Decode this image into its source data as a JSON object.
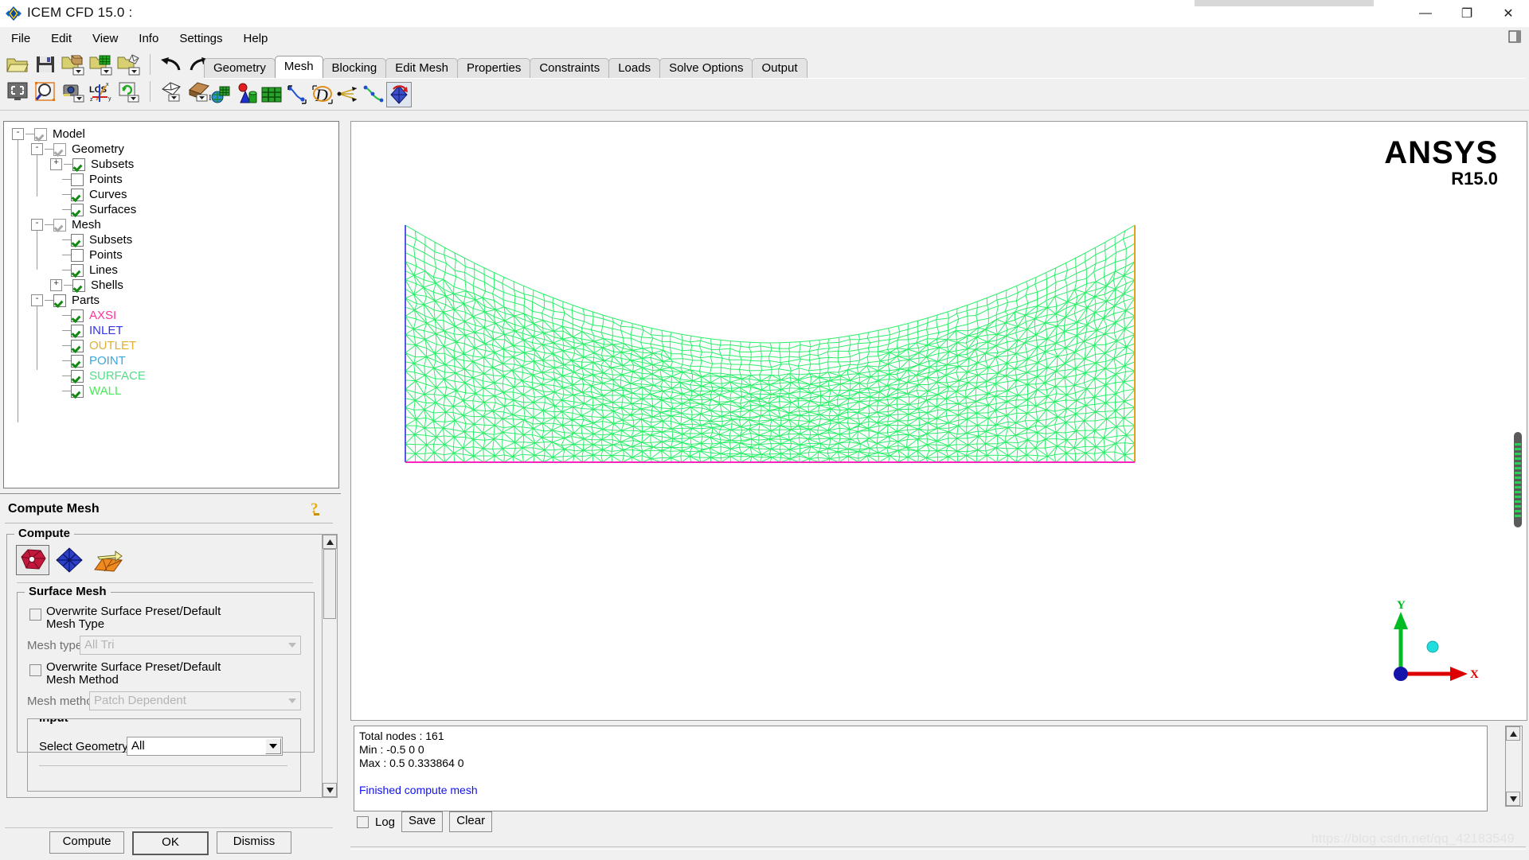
{
  "window": {
    "title": "ICEM CFD 15.0 :",
    "logo_icon": "ansys-diamond-icon",
    "minimize_label": "—",
    "maximize_label": "❐",
    "close_label": "✕",
    "dock_icon": "dock-icon"
  },
  "menubar": {
    "items": [
      {
        "label": "File"
      },
      {
        "label": "Edit"
      },
      {
        "label": "View"
      },
      {
        "label": "Info"
      },
      {
        "label": "Settings"
      },
      {
        "label": "Help"
      }
    ]
  },
  "toolbar": {
    "row1": [
      {
        "name": "open-folder-icon"
      },
      {
        "name": "save-icon"
      },
      {
        "name": "open-geometry-icon"
      },
      {
        "name": "open-mesh-icon"
      },
      {
        "name": "open-blocking-icon"
      },
      {
        "name": "undo-icon"
      },
      {
        "name": "redo-icon"
      }
    ],
    "row2": [
      {
        "name": "fit-window-icon"
      },
      {
        "name": "zoom-box-icon"
      },
      {
        "name": "save-picture-icon"
      },
      {
        "name": "lcs-axes-icon"
      },
      {
        "name": "refresh-icon"
      },
      {
        "name": "isometric-view-icon"
      },
      {
        "name": "box-view-icon"
      }
    ]
  },
  "tabs": {
    "items": [
      {
        "label": "Geometry",
        "active": false
      },
      {
        "label": "Mesh",
        "active": true
      },
      {
        "label": "Blocking",
        "active": false
      },
      {
        "label": "Edit Mesh",
        "active": false
      },
      {
        "label": "Properties",
        "active": false
      },
      {
        "label": "Constraints",
        "active": false
      },
      {
        "label": "Loads",
        "active": false
      },
      {
        "label": "Solve Options",
        "active": false
      },
      {
        "label": "Output",
        "active": false
      }
    ]
  },
  "mesh_toolbar": {
    "items": [
      {
        "name": "global-mesh-setup-icon",
        "selected": false
      },
      {
        "name": "part-mesh-setup-icon",
        "selected": false
      },
      {
        "name": "surface-mesh-setup-icon",
        "selected": false
      },
      {
        "name": "curve-mesh-setup-icon",
        "selected": false
      },
      {
        "name": "create-mesh-density-icon",
        "selected": false
      },
      {
        "name": "define-thin-cuts-icon",
        "selected": false
      },
      {
        "name": "edit-curve-mesh-icon",
        "selected": false
      },
      {
        "name": "compute-mesh-icon",
        "selected": true
      }
    ]
  },
  "tree": {
    "nodes": [
      {
        "label": "Model",
        "depth": 0,
        "toggle": "-",
        "check": "dim",
        "color": "#000000"
      },
      {
        "label": "Geometry",
        "depth": 1,
        "toggle": "-",
        "check": "dim",
        "color": "#000000"
      },
      {
        "label": "Subsets",
        "depth": 2,
        "toggle": "+",
        "check": "checked",
        "color": "#000000"
      },
      {
        "label": "Points",
        "depth": 2,
        "toggle": "",
        "check": "empty",
        "color": "#000000"
      },
      {
        "label": "Curves",
        "depth": 2,
        "toggle": "",
        "check": "checked",
        "color": "#000000"
      },
      {
        "label": "Surfaces",
        "depth": 2,
        "toggle": "",
        "check": "checked",
        "color": "#000000"
      },
      {
        "label": "Mesh",
        "depth": 1,
        "toggle": "-",
        "check": "dim",
        "color": "#000000"
      },
      {
        "label": "Subsets",
        "depth": 2,
        "toggle": "",
        "check": "checked",
        "color": "#000000"
      },
      {
        "label": "Points",
        "depth": 2,
        "toggle": "",
        "check": "empty",
        "color": "#000000"
      },
      {
        "label": "Lines",
        "depth": 2,
        "toggle": "",
        "check": "checked",
        "color": "#000000"
      },
      {
        "label": "Shells",
        "depth": 2,
        "toggle": "+",
        "check": "checked",
        "color": "#000000"
      },
      {
        "label": "Parts",
        "depth": 1,
        "toggle": "-",
        "check": "checked",
        "color": "#000000"
      },
      {
        "label": "AXSI",
        "depth": 2,
        "toggle": "",
        "check": "checked",
        "color": "#ff3399"
      },
      {
        "label": "INLET",
        "depth": 2,
        "toggle": "",
        "check": "checked",
        "color": "#3333ee"
      },
      {
        "label": "OUTLET",
        "depth": 2,
        "toggle": "",
        "check": "checked",
        "color": "#e0b030"
      },
      {
        "label": "POINT",
        "depth": 2,
        "toggle": "",
        "check": "checked",
        "color": "#3aa8e0"
      },
      {
        "label": "SURFACE",
        "depth": 2,
        "toggle": "",
        "check": "checked",
        "color": "#55dd88"
      },
      {
        "label": "WALL",
        "depth": 2,
        "toggle": "",
        "check": "checked",
        "color": "#44ee55"
      }
    ]
  },
  "compute_mesh": {
    "title": "Compute Mesh",
    "help_icon": "help-question-icon",
    "compute_group_label": "Compute",
    "compute_icons": [
      {
        "name": "volume-mesh-icon",
        "selected": true
      },
      {
        "name": "surface-mesh-icon",
        "selected": false
      },
      {
        "name": "prism-mesh-icon",
        "selected": false
      }
    ],
    "surface_mesh_group_label": "Surface Mesh",
    "overwrite_type_label_line1": "Overwrite Surface Preset/Default",
    "overwrite_type_label_line2": "Mesh Type",
    "mesh_type_label": "Mesh type",
    "mesh_type_value": "All Tri",
    "overwrite_method_label_line1": "Overwrite Surface Preset/Default",
    "overwrite_method_label_line2": "Mesh Method",
    "mesh_method_label": "Mesh method",
    "mesh_method_value": "Patch Dependent",
    "input_group_label": "Input",
    "select_geometry_label": "Select Geometry",
    "select_geometry_value": "All",
    "buttons": [
      {
        "label": "Compute",
        "name": "compute-button",
        "default": false
      },
      {
        "label": "OK",
        "name": "ok-button",
        "default": true
      },
      {
        "label": "Dismiss",
        "name": "dismiss-button",
        "default": false
      }
    ]
  },
  "viewport": {
    "brand_line1": "ANSYS",
    "brand_line2": "R15.0",
    "axis_x_label": "X",
    "axis_y_label": "Y",
    "axis_x_color": "#dd0000",
    "axis_y_color": "#00bb22",
    "origin_color": "#1414aa",
    "z_dot_color": "#22dddd",
    "mesh_color": "#2dee6a",
    "inlet_edge_color": "#5555ee",
    "outlet_edge_color": "#e0a020",
    "axsi_edge_color": "#ff22bb"
  },
  "messages": {
    "lines": [
      {
        "text": "Total nodes : 161",
        "color": "#000000"
      },
      {
        "text": "Min : -0.5 0 0",
        "color": "#000000"
      },
      {
        "text": "Max : 0.5 0.333864 0",
        "color": "#000000"
      },
      {
        "text": "",
        "color": "#000000"
      },
      {
        "text": "Finished compute mesh",
        "color": "#1111ee"
      }
    ],
    "log_checkbox_label": "Log",
    "save_label": "Save",
    "clear_label": "Clear"
  },
  "watermark": {
    "text": "https://blog.csdn.net/qq_42183549"
  }
}
